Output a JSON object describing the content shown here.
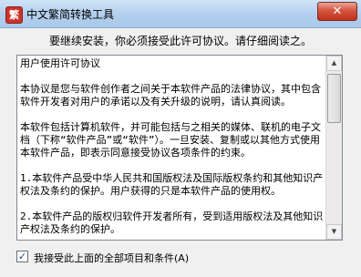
{
  "window": {
    "app_icon_glyph": "繁",
    "title": "中文繁简转换工具",
    "close_glyph": "✕"
  },
  "instruction": "要继续安装，你必须接受此许可协议。请仔细阅读之。",
  "license": {
    "text": "用户使用许可协议\n\n本协议是您与软件创作者之间关于本软件产品的法律协议，其中包含软件开发者对用户的承诺以及有关升级的说明，请认真阅读。\n\n本软件包括计算机软件，并可能包括与之相关的媒体、联机的电子文档（下称“软件产品”或“软件”）。一旦安装、复制或以其他方式使用本软件产品，即表示同意接受协议各项条件的约束。\n\n1.本软件产品受中华人民共和国版权法及国际版权条约和其他知识产权法及条约的保护。用户获得的只是本软件产品的使用权。\n\n2.本软件产品的版权归软件开发者所有，受到适用版权法及其他知识产权法及条约的保护。"
  },
  "scrollbar": {
    "up_glyph": "▲",
    "down_glyph": "▼"
  },
  "agree": {
    "checked": true,
    "check_glyph": "✓",
    "label": "我接受此上面的全部项目和条件(A)"
  }
}
